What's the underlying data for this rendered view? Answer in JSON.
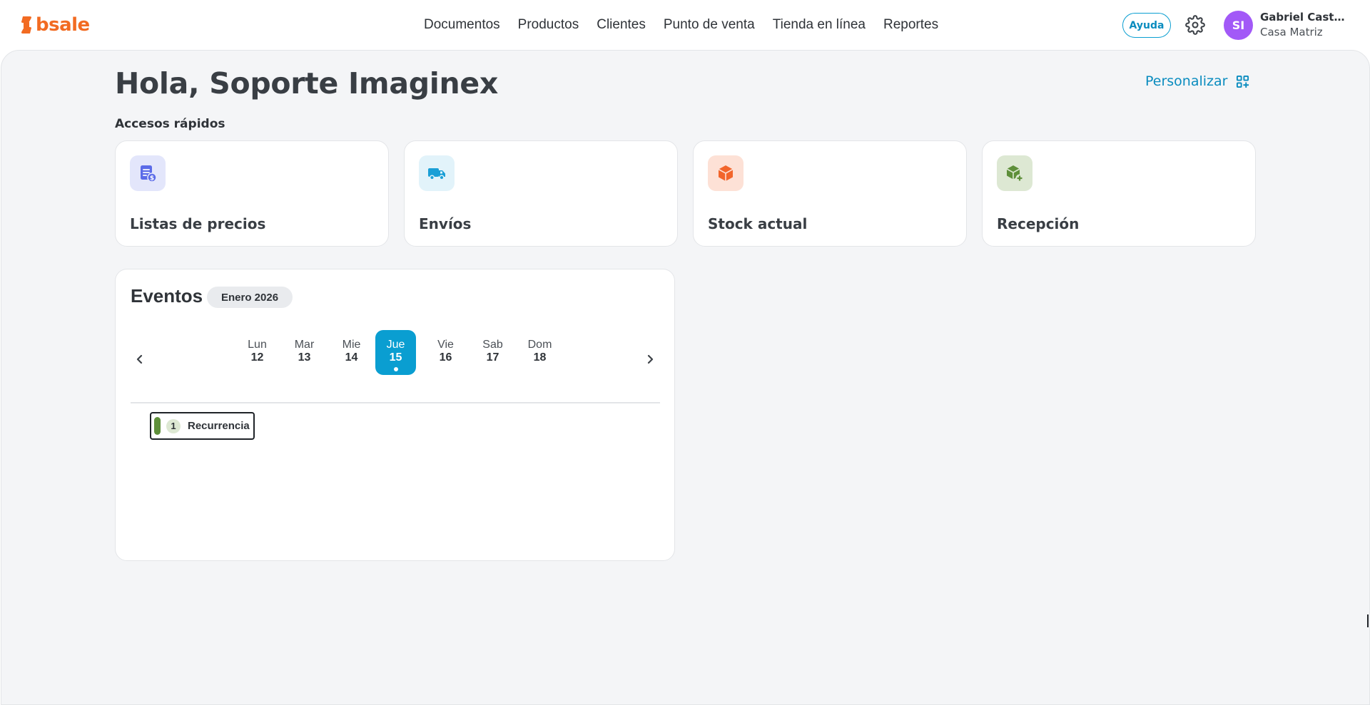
{
  "app": {
    "logo_text": "bsale",
    "brand_color": "#f26b22",
    "accent_color": "#0a9ed1"
  },
  "nav": {
    "items": [
      {
        "label": "Documentos"
      },
      {
        "label": "Productos"
      },
      {
        "label": "Clientes"
      },
      {
        "label": "Punto de venta"
      },
      {
        "label": "Tienda en línea"
      },
      {
        "label": "Reportes"
      }
    ]
  },
  "header": {
    "help_label": "Ayuda",
    "settings_icon": "gear-icon",
    "user": {
      "initials": "SI",
      "name": "Gabriel Casta...",
      "branch": "Casa Matriz",
      "avatar_color": "#a259f7"
    }
  },
  "main": {
    "greeting": "Hola, Soporte Imaginex",
    "personalize_label": "Personalizar",
    "quick_access_title": "Accesos rápidos",
    "quick_access": [
      {
        "label": "Listas de precios",
        "icon": "price-list-icon",
        "icon_color": "#5b6be8",
        "icon_bg": "#e3e6fb"
      },
      {
        "label": "Envíos",
        "icon": "truck-icon",
        "icon_color": "#1a9fd6",
        "icon_bg": "#e2f3fa"
      },
      {
        "label": "Stock actual",
        "icon": "box-icon",
        "icon_color": "#f2652b",
        "icon_bg": "#fde1d6"
      },
      {
        "label": "Recepción",
        "icon": "box-add-icon",
        "icon_color": "#5e8f3a",
        "icon_bg": "#dde8d3"
      }
    ]
  },
  "events": {
    "title": "Eventos",
    "month": "Enero 2026",
    "days": [
      {
        "name": "Lun",
        "num": "12",
        "selected": false
      },
      {
        "name": "Mar",
        "num": "13",
        "selected": false
      },
      {
        "name": "Mie",
        "num": "14",
        "selected": false
      },
      {
        "name": "Jue",
        "num": "15",
        "selected": true
      },
      {
        "name": "Vie",
        "num": "16",
        "selected": false
      },
      {
        "name": "Sab",
        "num": "17",
        "selected": false
      },
      {
        "name": "Dom",
        "num": "18",
        "selected": false
      }
    ],
    "items": [
      {
        "count": "1",
        "label": "Recurrencia",
        "color": "#5e8f3a"
      }
    ]
  }
}
